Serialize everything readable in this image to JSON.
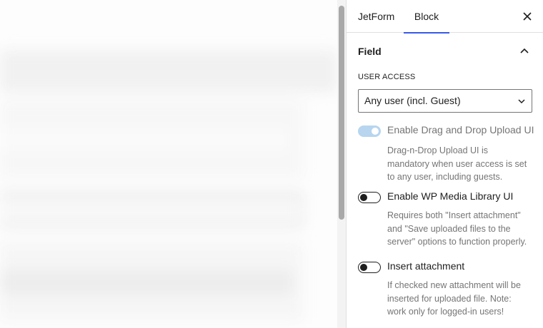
{
  "tabs": {
    "jetform": "JetForm",
    "block": "Block"
  },
  "section": {
    "title": "Field"
  },
  "user_access": {
    "label": "USER ACCESS",
    "selected": "Any user (incl. Guest)"
  },
  "toggles": [
    {
      "label": "Enable Drag and Drop Upload UI",
      "state": "on",
      "disabled": true,
      "help": "Drag-n-Drop Upload UI is mandatory when user access is set to any user, including guests."
    },
    {
      "label": "Enable WP Media Library UI",
      "state": "off",
      "disabled": false,
      "help": "Requires both \"Insert attachment\" and \"Save uploaded files to the server\" options to function properly."
    },
    {
      "label": "Insert attachment",
      "state": "off",
      "disabled": false,
      "help": "If checked new attachment will be inserted for uploaded file. Note: work only for logged-in users!"
    }
  ],
  "icons": {
    "close": "close-icon",
    "section_toggle": "chevron-up-icon",
    "select": "chevron-down-icon"
  },
  "colors": {
    "accent": "#3858e9",
    "toggle_disabled_on": "#b7d5ef",
    "help_text": "#757575"
  }
}
